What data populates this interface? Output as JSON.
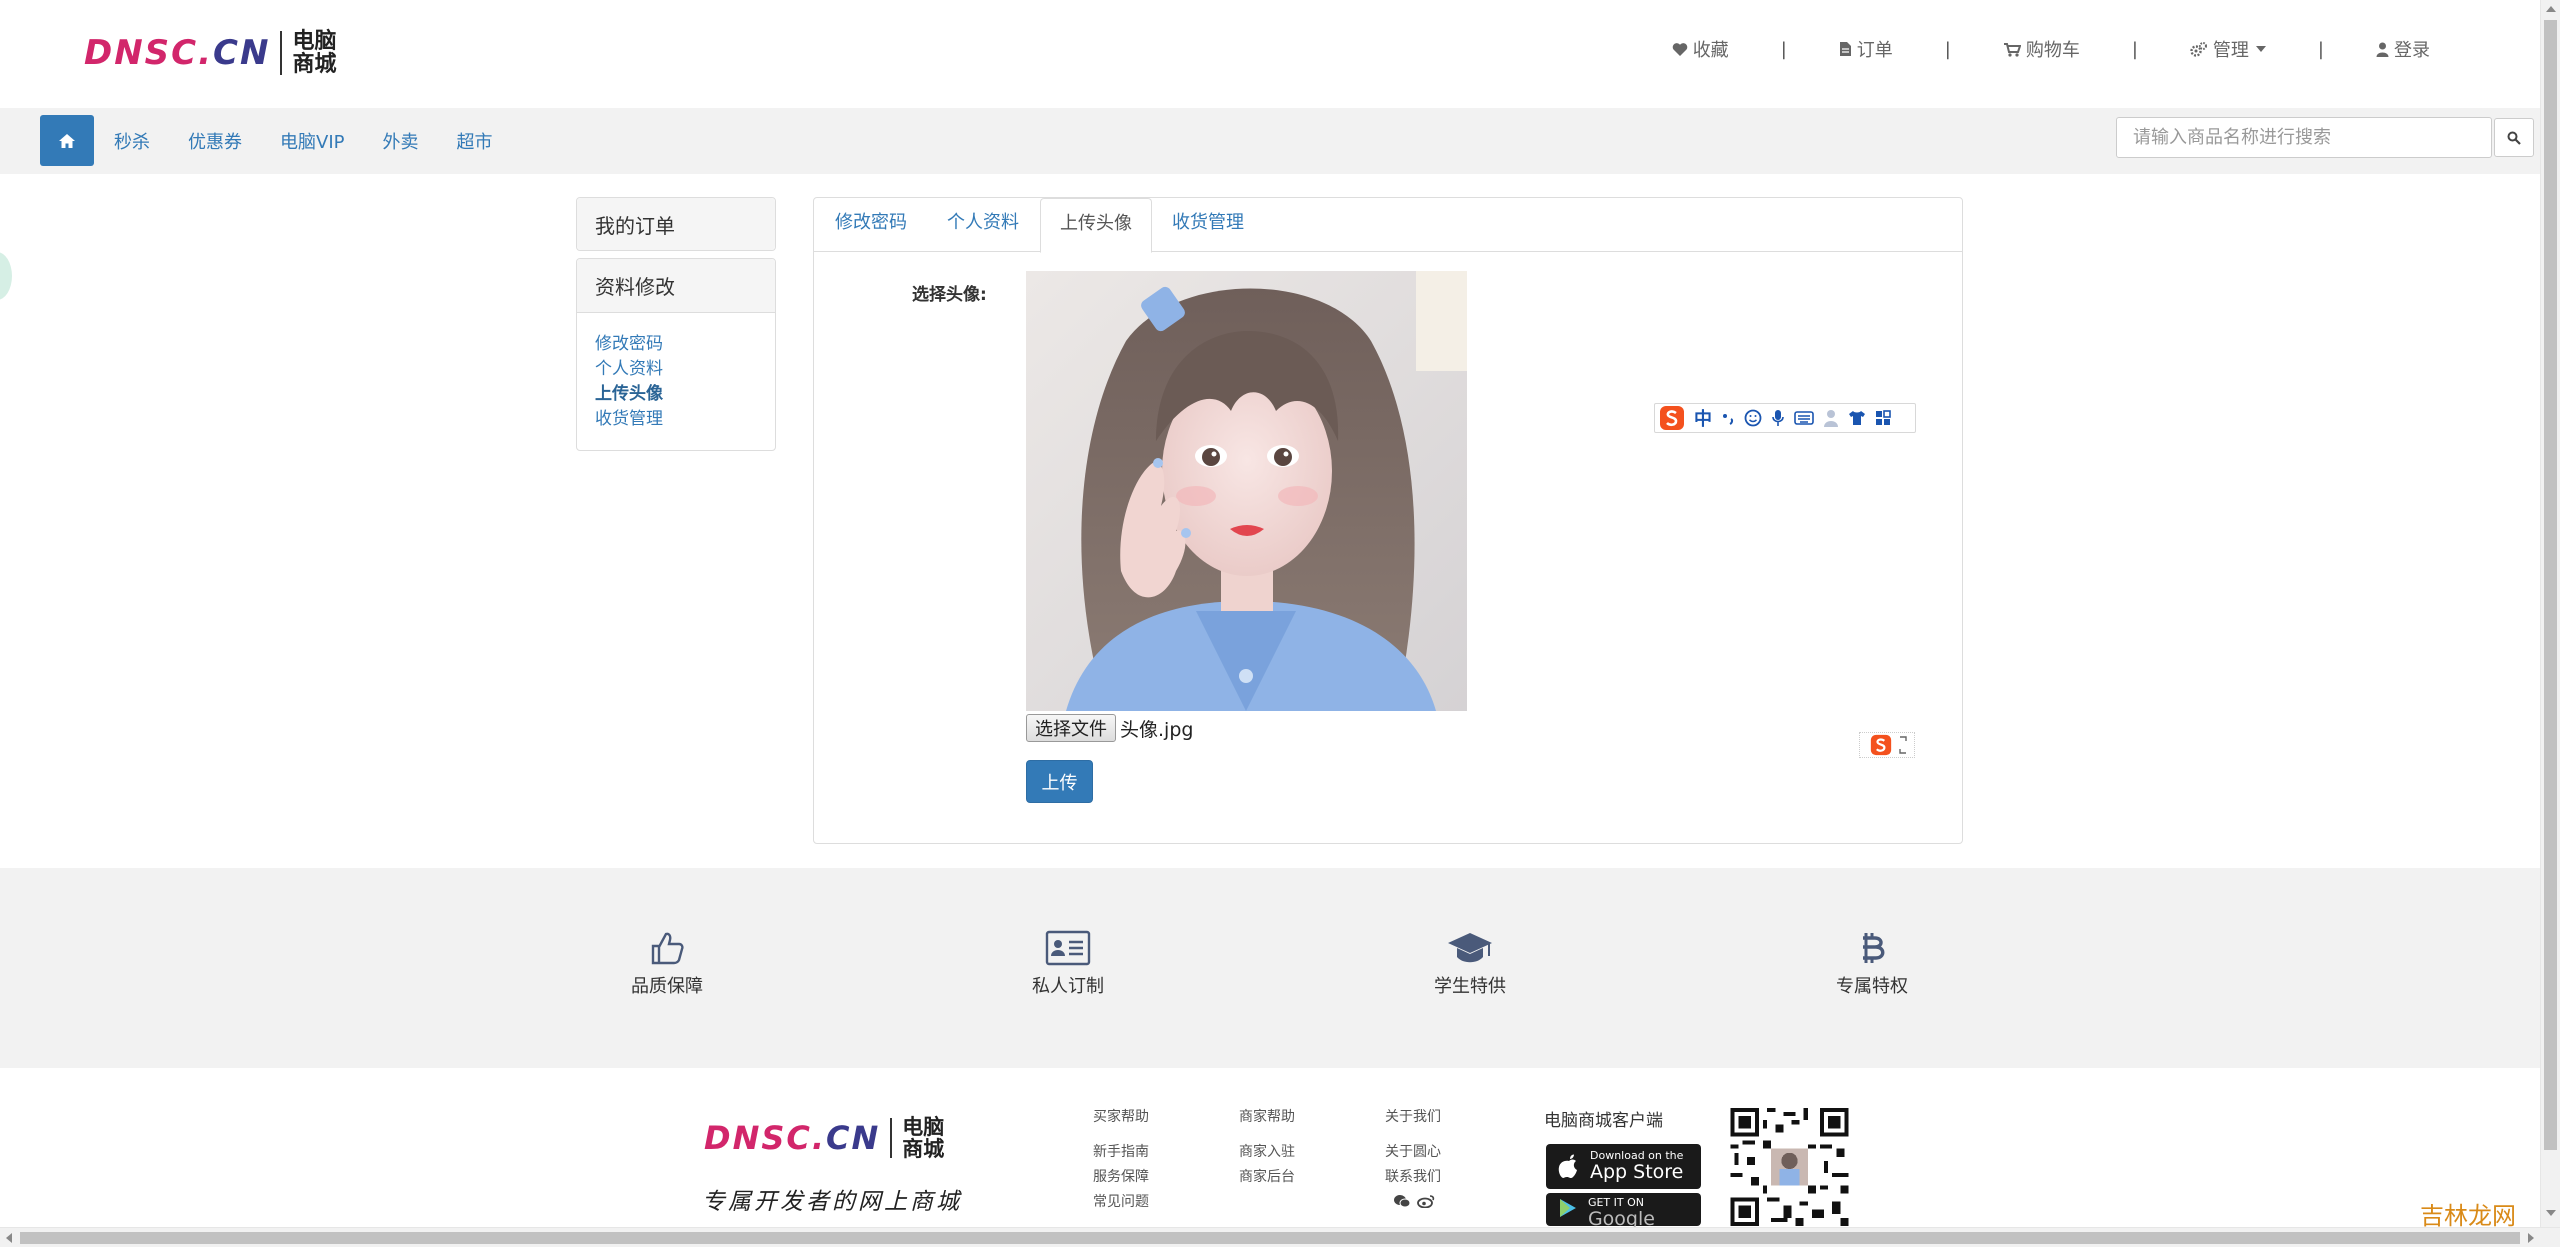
{
  "header": {
    "logo": {
      "latin_1": "DNSC.",
      "latin_2": "CN",
      "cn_line1": "电脑",
      "cn_line2": "商城"
    },
    "top_links": [
      {
        "label": "收藏",
        "icon": "heart-icon"
      },
      {
        "label": "订单",
        "icon": "file-icon"
      },
      {
        "label": "购物车",
        "icon": "cart-icon"
      },
      {
        "label": "管理",
        "icon": "cogs-icon",
        "dropdown": true
      },
      {
        "label": "登录",
        "icon": "user-icon"
      }
    ],
    "separator": "|"
  },
  "navbar": {
    "home_icon": "home-icon",
    "links": [
      "秒杀",
      "优惠券",
      "电脑VIP",
      "外卖",
      "超市"
    ],
    "search_placeholder": "请输入商品名称进行搜索",
    "search_value": "",
    "search_icon": "search-icon"
  },
  "sidebar": {
    "orders_heading": "我的订单",
    "profile_heading": "资料修改",
    "links": [
      "修改密码",
      "个人资料",
      "上传头像",
      "收货管理"
    ],
    "active_link": "上传头像"
  },
  "content": {
    "tabs": [
      "修改密码",
      "个人资料",
      "上传头像",
      "收货管理"
    ],
    "active_tab": "上传头像",
    "form_label": "选择头像:",
    "file_button": "选择文件",
    "file_name": "头像.jpg",
    "upload_button": "上传",
    "ime_cn_label": "中"
  },
  "features": [
    {
      "label": "品质保障",
      "icon": "thumbs-up-icon"
    },
    {
      "label": "私人订制",
      "icon": "id-card-icon"
    },
    {
      "label": "学生特供",
      "icon": "graduation-cap-icon"
    },
    {
      "label": "专属特权",
      "icon": "bitcoin-icon"
    }
  ],
  "footer": {
    "logo": {
      "latin_1": "DNSC.",
      "latin_2": "CN",
      "cn_line1": "电脑",
      "cn_line2": "商城"
    },
    "slogan": "专属开发者的网上商城",
    "columns": [
      {
        "heading": "买家帮助",
        "links": [
          "新手指南",
          "服务保障",
          "常见问题"
        ]
      },
      {
        "heading": "商家帮助",
        "links": [
          "商家入驻",
          "商家后台"
        ]
      },
      {
        "heading": "关于我们",
        "links": [
          "关于圆心",
          "联系我们"
        ],
        "social_icons": [
          "wechat-icon",
          "weibo-icon"
        ]
      }
    ],
    "app_title": "电脑商城客户端",
    "app_store": {
      "small": "Download on the",
      "big": "App Store"
    },
    "google_play": {
      "small": "GET IT ON",
      "big": "Google play"
    }
  },
  "watermark": "吉林龙网",
  "colors": {
    "primary": "#337ab7",
    "logo_pink": "#d2266b",
    "logo_navy": "#3a3a8c",
    "nav_bg": "#f2f2f2",
    "feature_icon": "#4a5a7a"
  }
}
